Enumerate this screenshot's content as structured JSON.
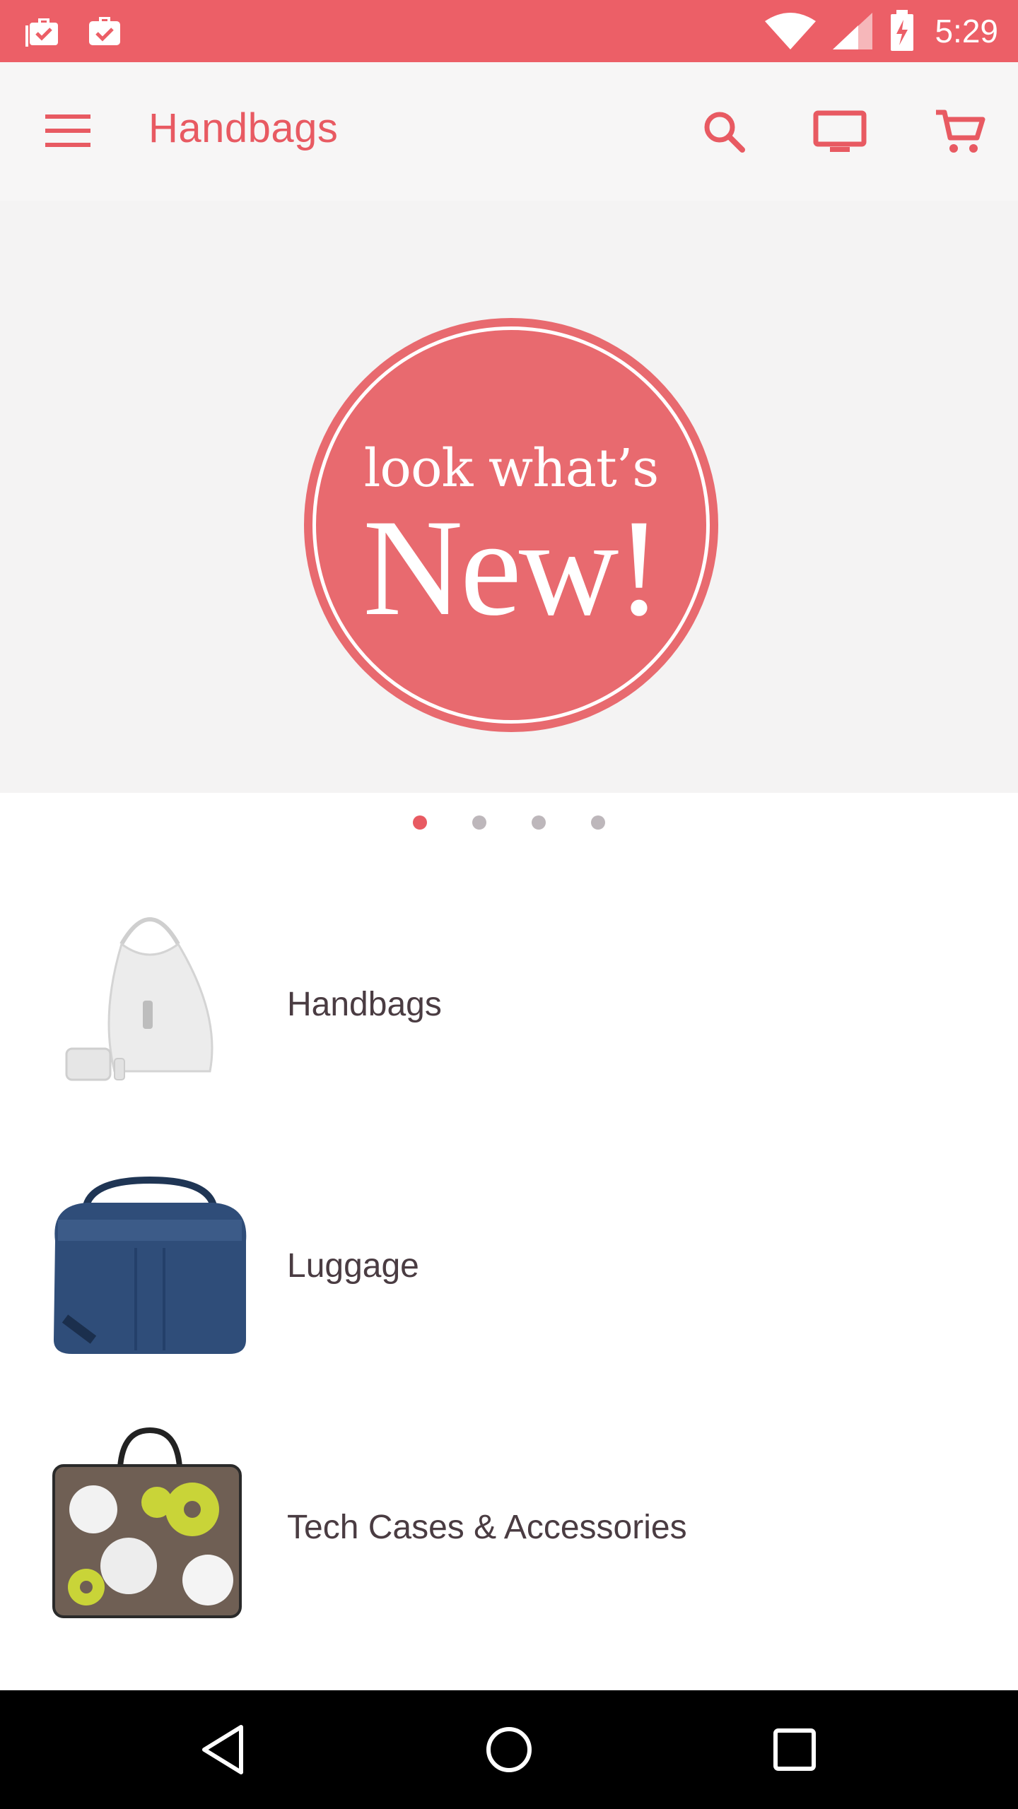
{
  "status_bar": {
    "time": "5:29",
    "icons": [
      "briefcase-check-icon",
      "briefcase-check-icon",
      "wifi-icon",
      "signal-icon",
      "battery-charging-icon"
    ]
  },
  "app_bar": {
    "title": "Handbags",
    "actions": [
      "search-icon",
      "cast-icon",
      "cart-icon"
    ]
  },
  "banner": {
    "line1": "look what’s",
    "line2": "New!",
    "badge_color": "#e86a6f"
  },
  "pager": {
    "count": 4,
    "active_index": 0
  },
  "categories": [
    {
      "label": "Handbags",
      "thumb": "white-handbag-image"
    },
    {
      "label": "Luggage",
      "thumb": "navy-duffel-bag-image"
    },
    {
      "label": "Tech Cases & Accessories",
      "thumb": "floral-laptop-case-image"
    }
  ],
  "nav_bar": {
    "buttons": [
      "back-icon",
      "home-icon",
      "recents-icon"
    ]
  },
  "colors": {
    "accent": "#ec5f67",
    "title": "#e85a62",
    "text": "#4a3c42"
  }
}
